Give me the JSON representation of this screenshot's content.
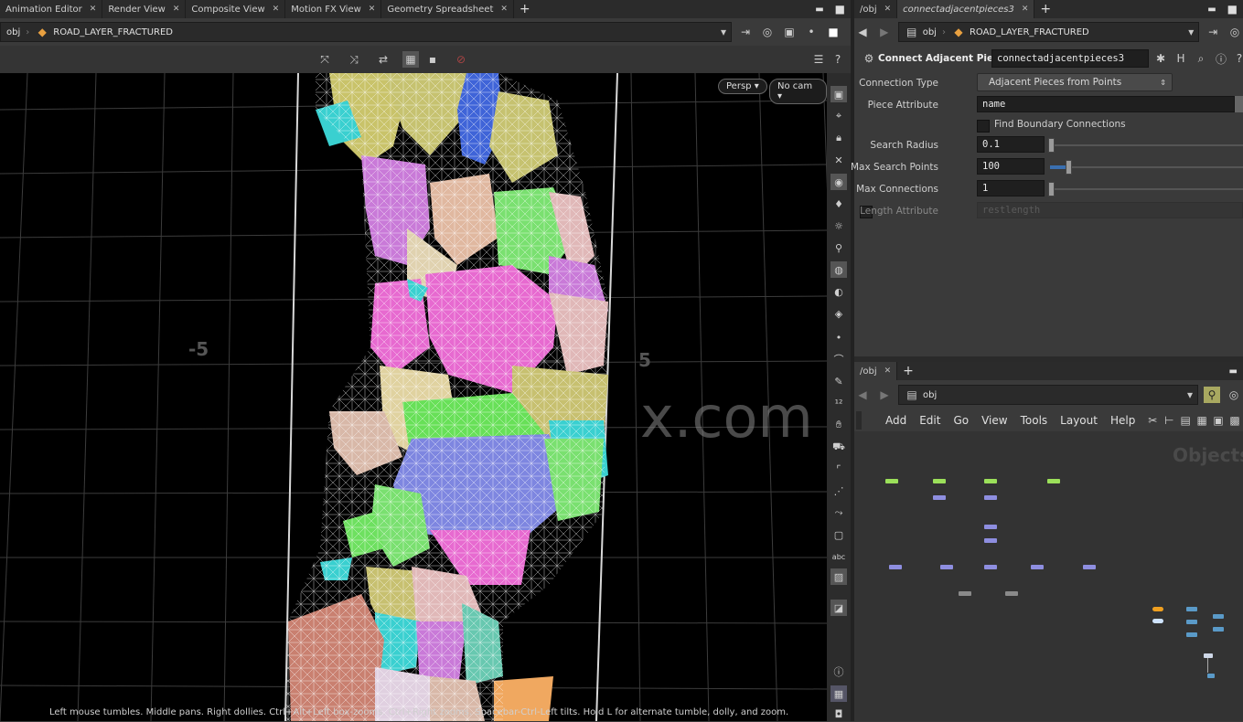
{
  "left_tabs": [
    {
      "label": "Animation Editor"
    },
    {
      "label": "Render View"
    },
    {
      "label": "Composite View"
    },
    {
      "label": "Motion FX View"
    },
    {
      "label": "Geometry Spreadsheet"
    }
  ],
  "left_path": {
    "root": "obj",
    "node": "ROAD_LAYER_FRACTURED"
  },
  "viewport": {
    "persp_label": "Persp",
    "cam_label": "No cam",
    "axis_neg": "-5",
    "axis_pos": "5",
    "watermark": "x.com",
    "status_text": "Left mouse tumbles. Middle pans. Right dollies. Ctrl+Alt+Left box-zooms. Ctrl+Right zooms. Spacebar-Ctrl-Left tilts. Hold L for alternate tumble, dolly, and zoom."
  },
  "param_tabs": [
    {
      "label": "/obj"
    },
    {
      "label": "connectadjacentpieces3"
    }
  ],
  "param_path": {
    "root": "obj",
    "node": "ROAD_LAYER_FRACTURED"
  },
  "node_header": {
    "type_label": "Connect Adjacent Pieces",
    "node_name": "connectadjacentpieces3"
  },
  "params": {
    "connection_type": {
      "label": "Connection Type",
      "value": "Adjacent Pieces from Points"
    },
    "piece_attribute": {
      "label": "Piece Attribute",
      "value": "name"
    },
    "find_boundary": {
      "label": "Find Boundary Connections"
    },
    "search_radius": {
      "label": "Search Radius",
      "value": "0.1"
    },
    "max_search_points": {
      "label": "Max Search Points",
      "value": "100"
    },
    "max_connections": {
      "label": "Max Connections",
      "value": "1"
    },
    "length_attribute": {
      "label": "Length Attribute",
      "value": "restlength"
    }
  },
  "net_tabs": [
    {
      "label": "/obj"
    }
  ],
  "net_path": {
    "root": "obj"
  },
  "net_menu": {
    "add": "Add",
    "edit": "Edit",
    "go": "Go",
    "view": "View",
    "tools": "Tools",
    "layout": "Layout",
    "help": "Help"
  },
  "net_watermark": "Objects",
  "colors": {
    "green_node": "#9be05a",
    "purple_node": "#8e8ee0",
    "gray_node": "#8a8a8a",
    "orange_node": "#f0a020",
    "blue_node": "#5a9ac8",
    "active_blue": "#3a6fb0"
  }
}
